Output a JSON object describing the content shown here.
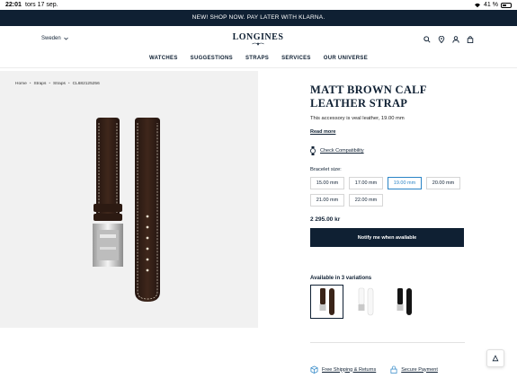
{
  "status_bar": {
    "time": "22:01",
    "date": "tors 17 sep.",
    "battery": "41 %"
  },
  "promo": {
    "text": "NEW! SHOP NOW. PAY LATER WITH KLARNA."
  },
  "header": {
    "country": "Sweden",
    "logo": "LONGINES",
    "icons": [
      "search-icon",
      "location-pin-icon",
      "user-icon",
      "bag-icon"
    ],
    "nav": [
      "WATCHES",
      "SUGGESTIONS",
      "STRAPS",
      "SERVICES",
      "OUR UNIVERSE"
    ]
  },
  "breadcrumb": [
    "Home",
    "Straps",
    "Straps",
    "CL682125256"
  ],
  "product": {
    "title_line1": "MATT BROWN CALF",
    "title_line2": "LEATHER STRAP",
    "description": "This accessory is veal leather, 19.00 mm",
    "read_more": "Read more",
    "check_compat": "Check Compatibility",
    "size_label": "Bracelet size:",
    "sizes": [
      "15.00 mm",
      "17.00 mm",
      "19.00 mm",
      "20.00 mm",
      "21.00 mm",
      "22.00 mm"
    ],
    "selected_size": "19.00 mm",
    "price": "2 295.00 kr",
    "notify_label": "Notify me when available",
    "variations_label": "Available in 3 variations"
  },
  "features": {
    "shipping": "Free Shipping & Returns",
    "payment": "Secure Payment"
  },
  "colors": {
    "navy": "#0f2033",
    "accent": "#2a84c6",
    "panel": "#f1f1f1",
    "leather": "#3a2419"
  }
}
